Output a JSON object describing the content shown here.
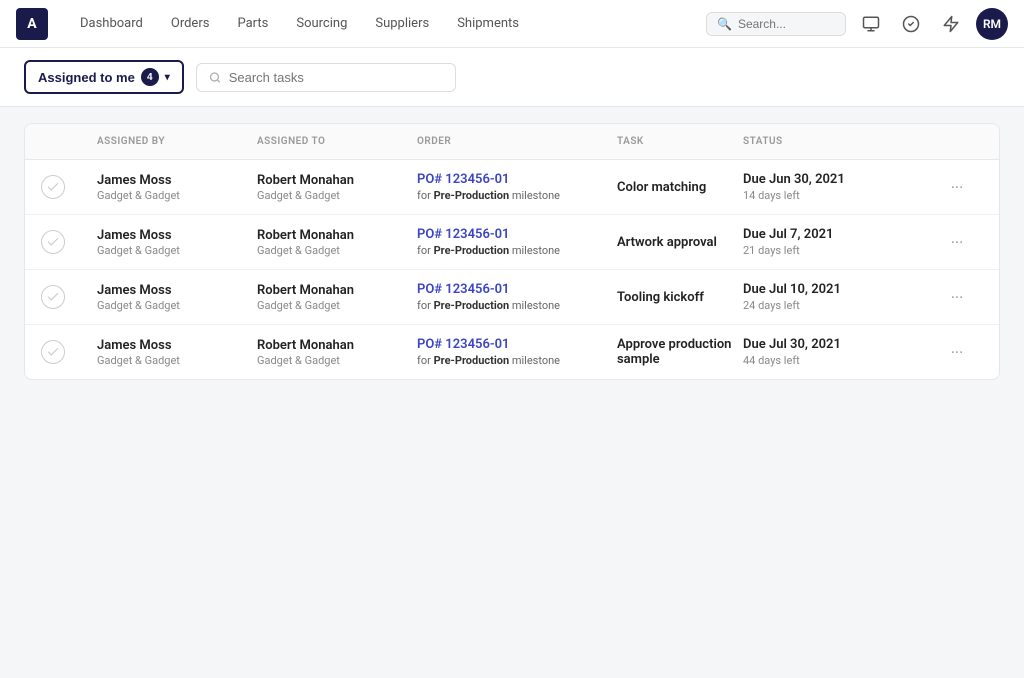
{
  "app": {
    "logo_text": "A",
    "nav_links": [
      "Dashboard",
      "Orders",
      "Parts",
      "Sourcing",
      "Suppliers",
      "Shipments"
    ],
    "search_placeholder": "Search...",
    "avatar_initials": "RM"
  },
  "toolbar": {
    "filter_label": "Assigned to me",
    "filter_count": "4",
    "search_placeholder": "Search tasks"
  },
  "table": {
    "columns": [
      "",
      "ASSIGNED BY",
      "ASSIGNED TO",
      "ORDER",
      "TASK",
      "STATUS",
      ""
    ],
    "rows": [
      {
        "assigned_by_name": "James Moss",
        "assigned_by_company": "Gadget & Gadget",
        "assigned_to_name": "Robert Monahan",
        "assigned_to_company": "Gadget & Gadget",
        "order_link": "PO# 123456-01",
        "order_milestone_prefix": "for ",
        "order_milestone_bold": "Pre-Production",
        "order_milestone_suffix": " milestone",
        "task_name": "Color matching",
        "due_date": "Due Jun 30, 2021",
        "days_left": "14 days left"
      },
      {
        "assigned_by_name": "James Moss",
        "assigned_by_company": "Gadget & Gadget",
        "assigned_to_name": "Robert Monahan",
        "assigned_to_company": "Gadget & Gadget",
        "order_link": "PO# 123456-01",
        "order_milestone_prefix": "for ",
        "order_milestone_bold": "Pre-Production",
        "order_milestone_suffix": " milestone",
        "task_name": "Artwork approval",
        "due_date": "Due Jul 7, 2021",
        "days_left": "21 days left"
      },
      {
        "assigned_by_name": "James Moss",
        "assigned_by_company": "Gadget & Gadget",
        "assigned_to_name": "Robert Monahan",
        "assigned_to_company": "Gadget & Gadget",
        "order_link": "PO# 123456-01",
        "order_milestone_prefix": "for ",
        "order_milestone_bold": "Pre-Production",
        "order_milestone_suffix": " milestone",
        "task_name": "Tooling kickoff",
        "due_date": "Due Jul 10, 2021",
        "days_left": "24 days left"
      },
      {
        "assigned_by_name": "James Moss",
        "assigned_by_company": "Gadget & Gadget",
        "assigned_to_name": "Robert Monahan",
        "assigned_to_company": "Gadget & Gadget",
        "order_link": "PO# 123456-01",
        "order_milestone_prefix": "for ",
        "order_milestone_bold": "Pre-Production",
        "order_milestone_suffix": " milestone",
        "task_name": "Approve production sample",
        "due_date": "Due Jul 30, 2021",
        "days_left": "44 days left"
      }
    ]
  },
  "icons": {
    "search": "🔍",
    "monitor": "🖥",
    "check_circle": "✓",
    "bolt": "⚡",
    "chevron_down": "▾",
    "more": "···"
  }
}
